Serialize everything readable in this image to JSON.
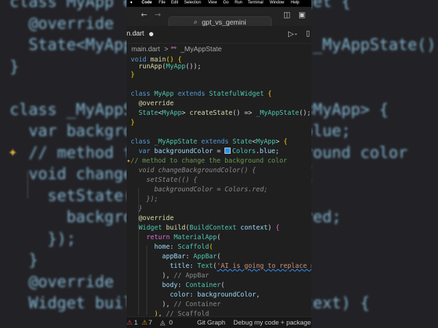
{
  "menubar": {
    "apple": "",
    "items": [
      "Code",
      "File",
      "Edit",
      "Selection",
      "View",
      "Go",
      "Run",
      "Terminal",
      "Window",
      "Help"
    ]
  },
  "titlebar": {
    "search_text": "gpt_vs_gemini"
  },
  "tab": {
    "filename": "n.dart"
  },
  "breadcrumb": {
    "file": "main.dart",
    "separator": ">",
    "symbol": "_MyAppState"
  },
  "code_lines": [
    {
      "text": "void main() {"
    },
    {
      "text": "  runApp(MyApp());"
    },
    {
      "text": "}"
    },
    {
      "text": ""
    },
    {
      "text": "class MyApp extends StatefulWidget {"
    },
    {
      "text": "  @override"
    },
    {
      "text": "  State<MyApp> createState() => _MyAppState();"
    },
    {
      "text": "}"
    },
    {
      "text": ""
    },
    {
      "text": "class _MyAppState extends State<MyApp> {"
    },
    {
      "text": "  var backgroundColor = Colors.blue;"
    },
    {
      "text": "  // method to change the background color"
    },
    {
      "text": "  void changeBackgroundColor() {"
    },
    {
      "text": "    setState(() {"
    },
    {
      "text": "      backgroundColor = Colors.red;"
    },
    {
      "text": "    });"
    },
    {
      "text": "  }"
    },
    {
      "text": "  @override"
    },
    {
      "text": "  Widget build(BuildContext context) {"
    },
    {
      "text": "    return MaterialApp("
    },
    {
      "text": "      home: Scaffold("
    },
    {
      "text": "        appBar: AppBar("
    },
    {
      "text": "          title: Text('AI is going to replace me"
    },
    {
      "text": "        ), // AppBar"
    },
    {
      "text": "        body: Container("
    },
    {
      "text": "          color: backgroundColor,"
    },
    {
      "text": "        ), // Container"
    },
    {
      "text": "      ), // Scaffold"
    }
  ],
  "statusbar": {
    "errors": "1",
    "warnings": "7",
    "info": "0",
    "git_graph": "Git Graph",
    "debug": "Debug my code + package"
  },
  "background_code": "class MyApp extends StatefulWidget {\n  @override\n  State<MyApp> createState() => _MyAppState();\n}\n\nclass _MyAppState extends State<MyApp> {\n  var backgroundColor = Colors.blue;\n  // method to change the background color\n  void changeBackgroundColor() {\n    setState(() {\n      backgroundColor = Colors.red;\n    });\n  }\n  @override\n  Widget build(BuildContext context) {",
  "colors": {
    "keyword": "#569cd6",
    "type": "#4ec9b0",
    "function": "#dcdcaa",
    "variable": "#9cdcfe",
    "string": "#ce9178",
    "comment": "#6a9955",
    "swatch_blue": "#2196f3"
  }
}
